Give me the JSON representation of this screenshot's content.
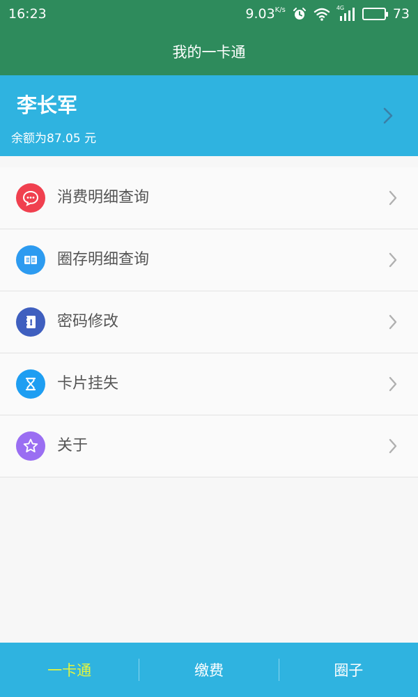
{
  "status_bar": {
    "time": "16:23",
    "net_speed": "9.03",
    "net_unit": "K/s",
    "network_type": "4G",
    "battery": "73",
    "battery_level": 0.73,
    "icons": [
      "alarm-icon",
      "wifi-icon",
      "signal-icon",
      "battery-icon"
    ]
  },
  "header": {
    "title": "我的一卡通"
  },
  "user": {
    "name": "李长军",
    "balance_text": "余额为87.05 元"
  },
  "menu": {
    "items": [
      {
        "label": "消费明细查询",
        "icon": "chat-bubble-icon",
        "color": "#f0404f"
      },
      {
        "label": "圈存明细查询",
        "icon": "book-icon",
        "color": "#2d9bf0"
      },
      {
        "label": "密码修改",
        "icon": "lock-notebook-icon",
        "color": "#3f5fbf"
      },
      {
        "label": "卡片挂失",
        "icon": "hourglass-icon",
        "color": "#1e9ef2"
      },
      {
        "label": "关于",
        "icon": "star-icon",
        "color": "#9a6ef2"
      }
    ]
  },
  "tabs": {
    "items": [
      {
        "label": "一卡通",
        "active": true
      },
      {
        "label": "缴费",
        "active": false
      },
      {
        "label": "圈子",
        "active": false
      }
    ],
    "active_color": "#e5f53c"
  },
  "colors": {
    "header_bg": "#2e8b5c",
    "card_bg": "#2fb3e0",
    "tab_bg": "#2fb3e0",
    "list_text": "#555555"
  }
}
